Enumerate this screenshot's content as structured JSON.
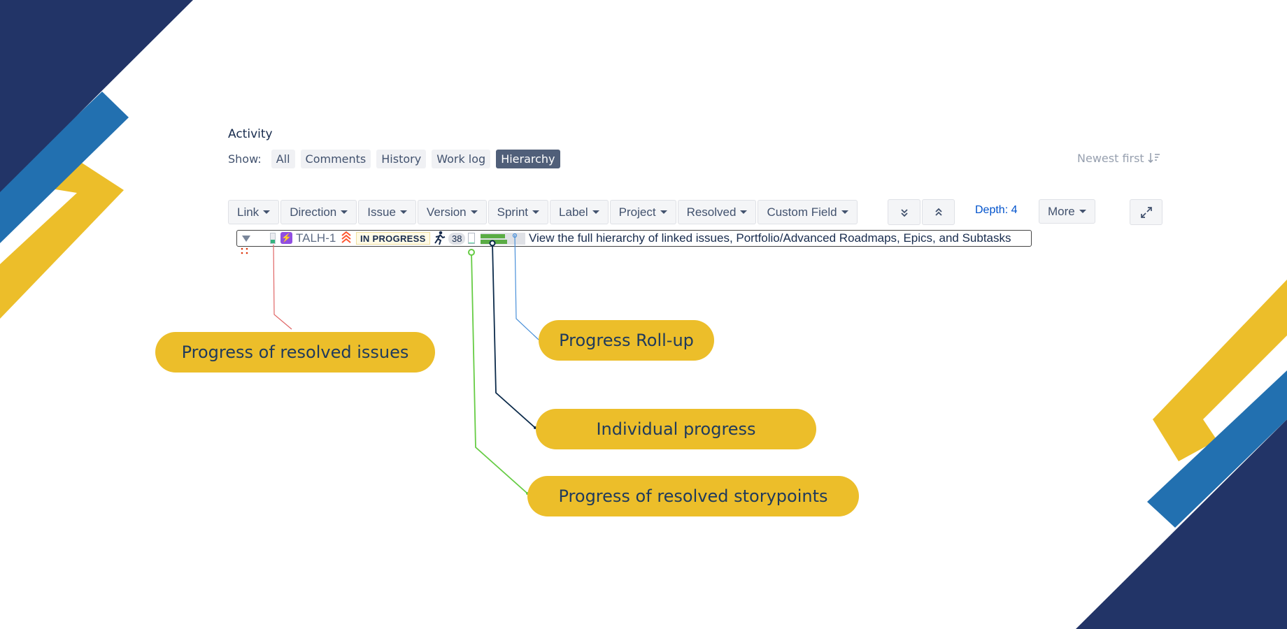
{
  "activity": {
    "title": "Activity",
    "show_label": "Show:",
    "tabs": [
      {
        "label": "All",
        "active": false
      },
      {
        "label": "Comments",
        "active": false
      },
      {
        "label": "History",
        "active": false
      },
      {
        "label": "Work log",
        "active": false
      },
      {
        "label": "Hierarchy",
        "active": true
      }
    ],
    "sort_label": "Newest first"
  },
  "toolbar": {
    "filters": [
      "Link",
      "Direction",
      "Issue",
      "Version",
      "Sprint",
      "Label",
      "Project",
      "Resolved",
      "Custom Field"
    ],
    "depth_label": "Depth: 4",
    "more_label": "More"
  },
  "hierarchy_row": {
    "issue_key": "TALH-1",
    "status": "IN PROGRESS",
    "story_points": "38",
    "resolved_issues_fraction": 0.35,
    "resolved_storypoints_fraction": 0.1,
    "individual_progress_fraction": 0.55,
    "rollup_progress_fraction": 0.6,
    "summary": "View the full hierarchy of linked issues, Portfolio/Advanced Roadmaps, Epics, and Subtasks"
  },
  "callouts": {
    "resolved_issues": "Progress of resolved issues",
    "rollup": "Progress Roll-up",
    "individual": "Individual progress",
    "resolved_storypoints": "Progress of resolved storypoints"
  },
  "colors": {
    "navy": "#223467",
    "blue": "#2270b0",
    "yellow": "#ecbe2a",
    "lozenge_bg": "#fffae6",
    "progress_green": "#5aac44"
  }
}
